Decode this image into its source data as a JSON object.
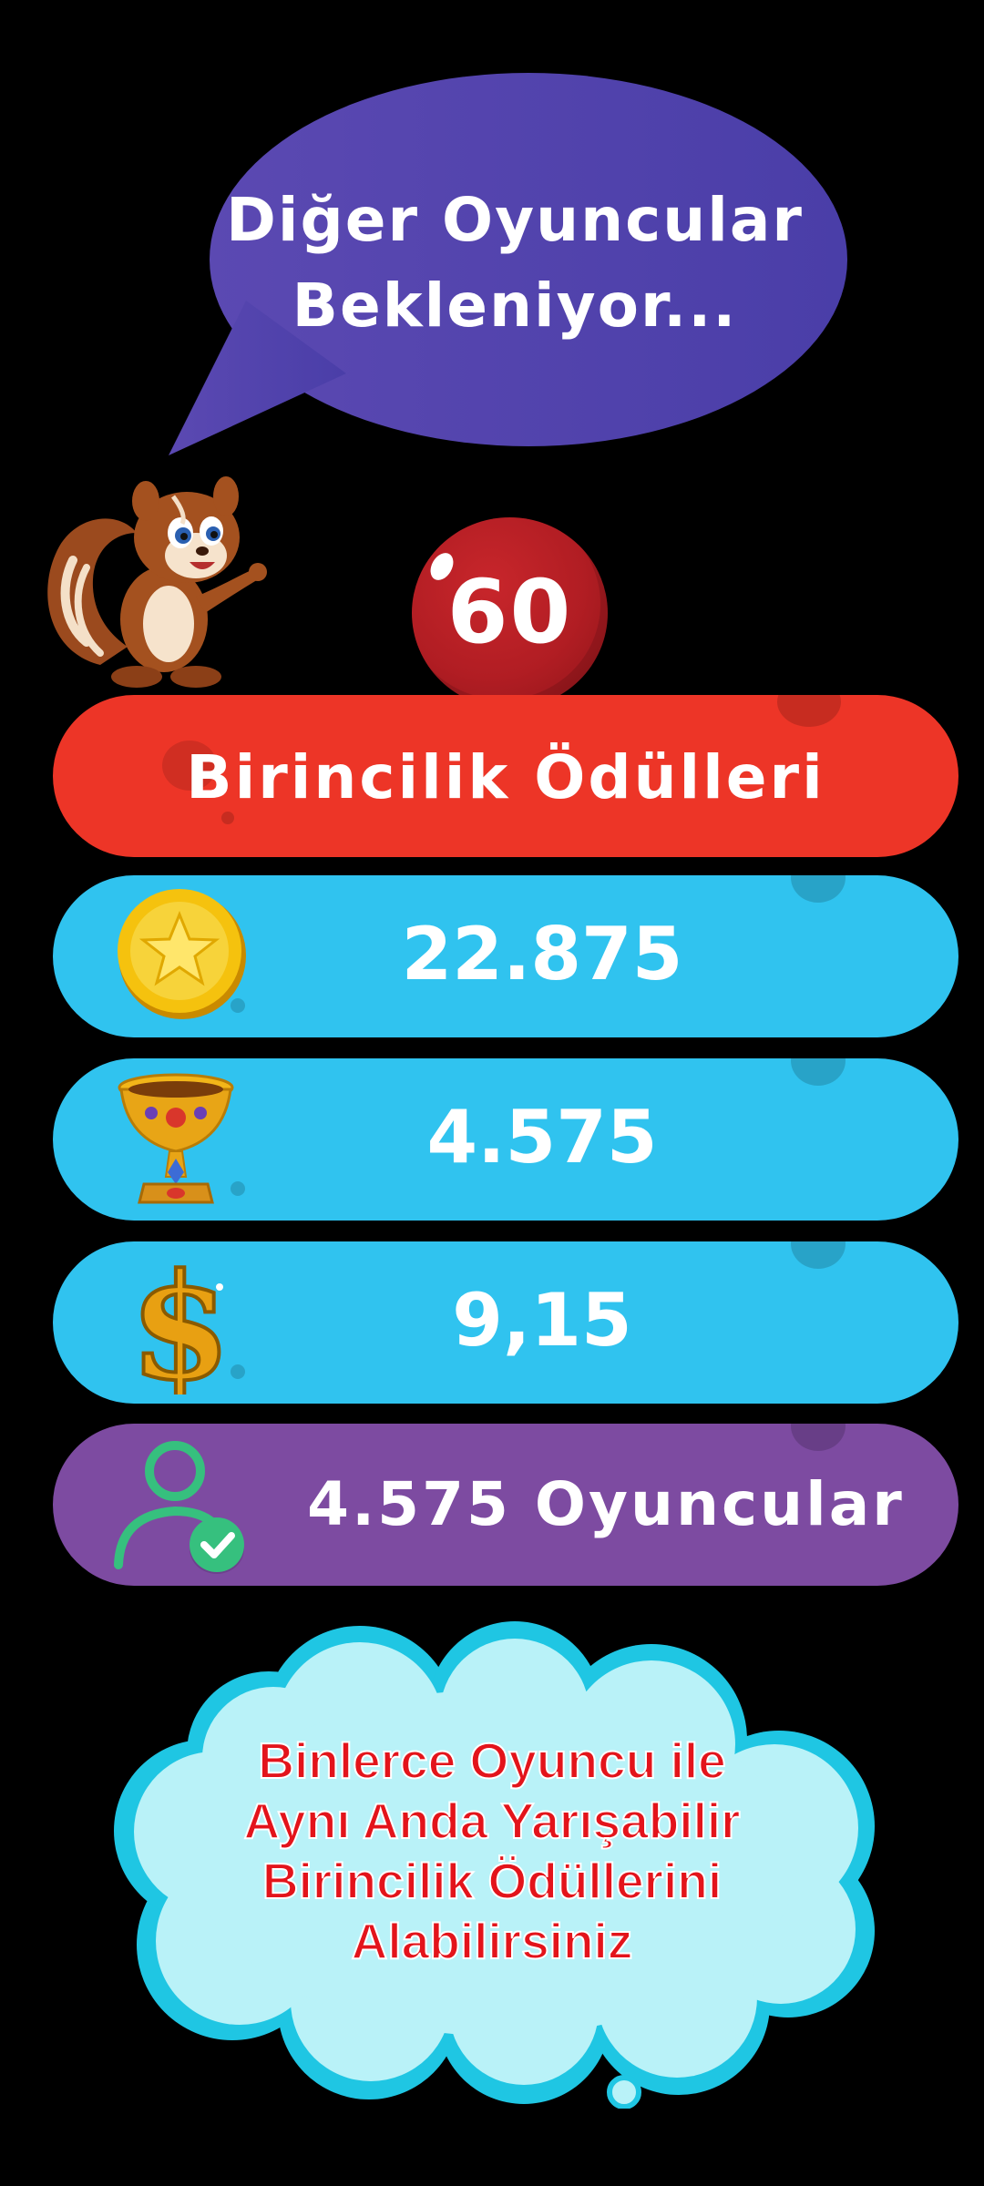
{
  "header": {
    "status_line1": "Diğer Oyuncular",
    "status_line2": "Bekleniyor..."
  },
  "mascot": {
    "icon": "squirrel-mascot-icon"
  },
  "timer": {
    "value": "60",
    "color": "#b11d23"
  },
  "rewards": {
    "title": "Birincilik Ödülleri",
    "title_color": "#ed3527",
    "coins": {
      "icon": "gold-star-coin-icon",
      "value": "22.875"
    },
    "trophy": {
      "icon": "jeweled-trophy-icon",
      "value": "4.575"
    },
    "cash": {
      "icon": "dollar-sign-icon",
      "value": "9,15"
    },
    "players": {
      "icon": "user-verified-icon",
      "value": "4.575 Oyuncular"
    },
    "row_color": "#30c3ef",
    "players_color": "#7d4ba1"
  },
  "promo": {
    "line1": "Binlerce Oyuncu ile",
    "line2": "Aynı Anda Yarışabilir",
    "line3": "Birincilik Ödüllerini",
    "line4": "Alabilirsiniz",
    "text_color": "#e3141b",
    "cloud_color": "#b9f2f8"
  }
}
